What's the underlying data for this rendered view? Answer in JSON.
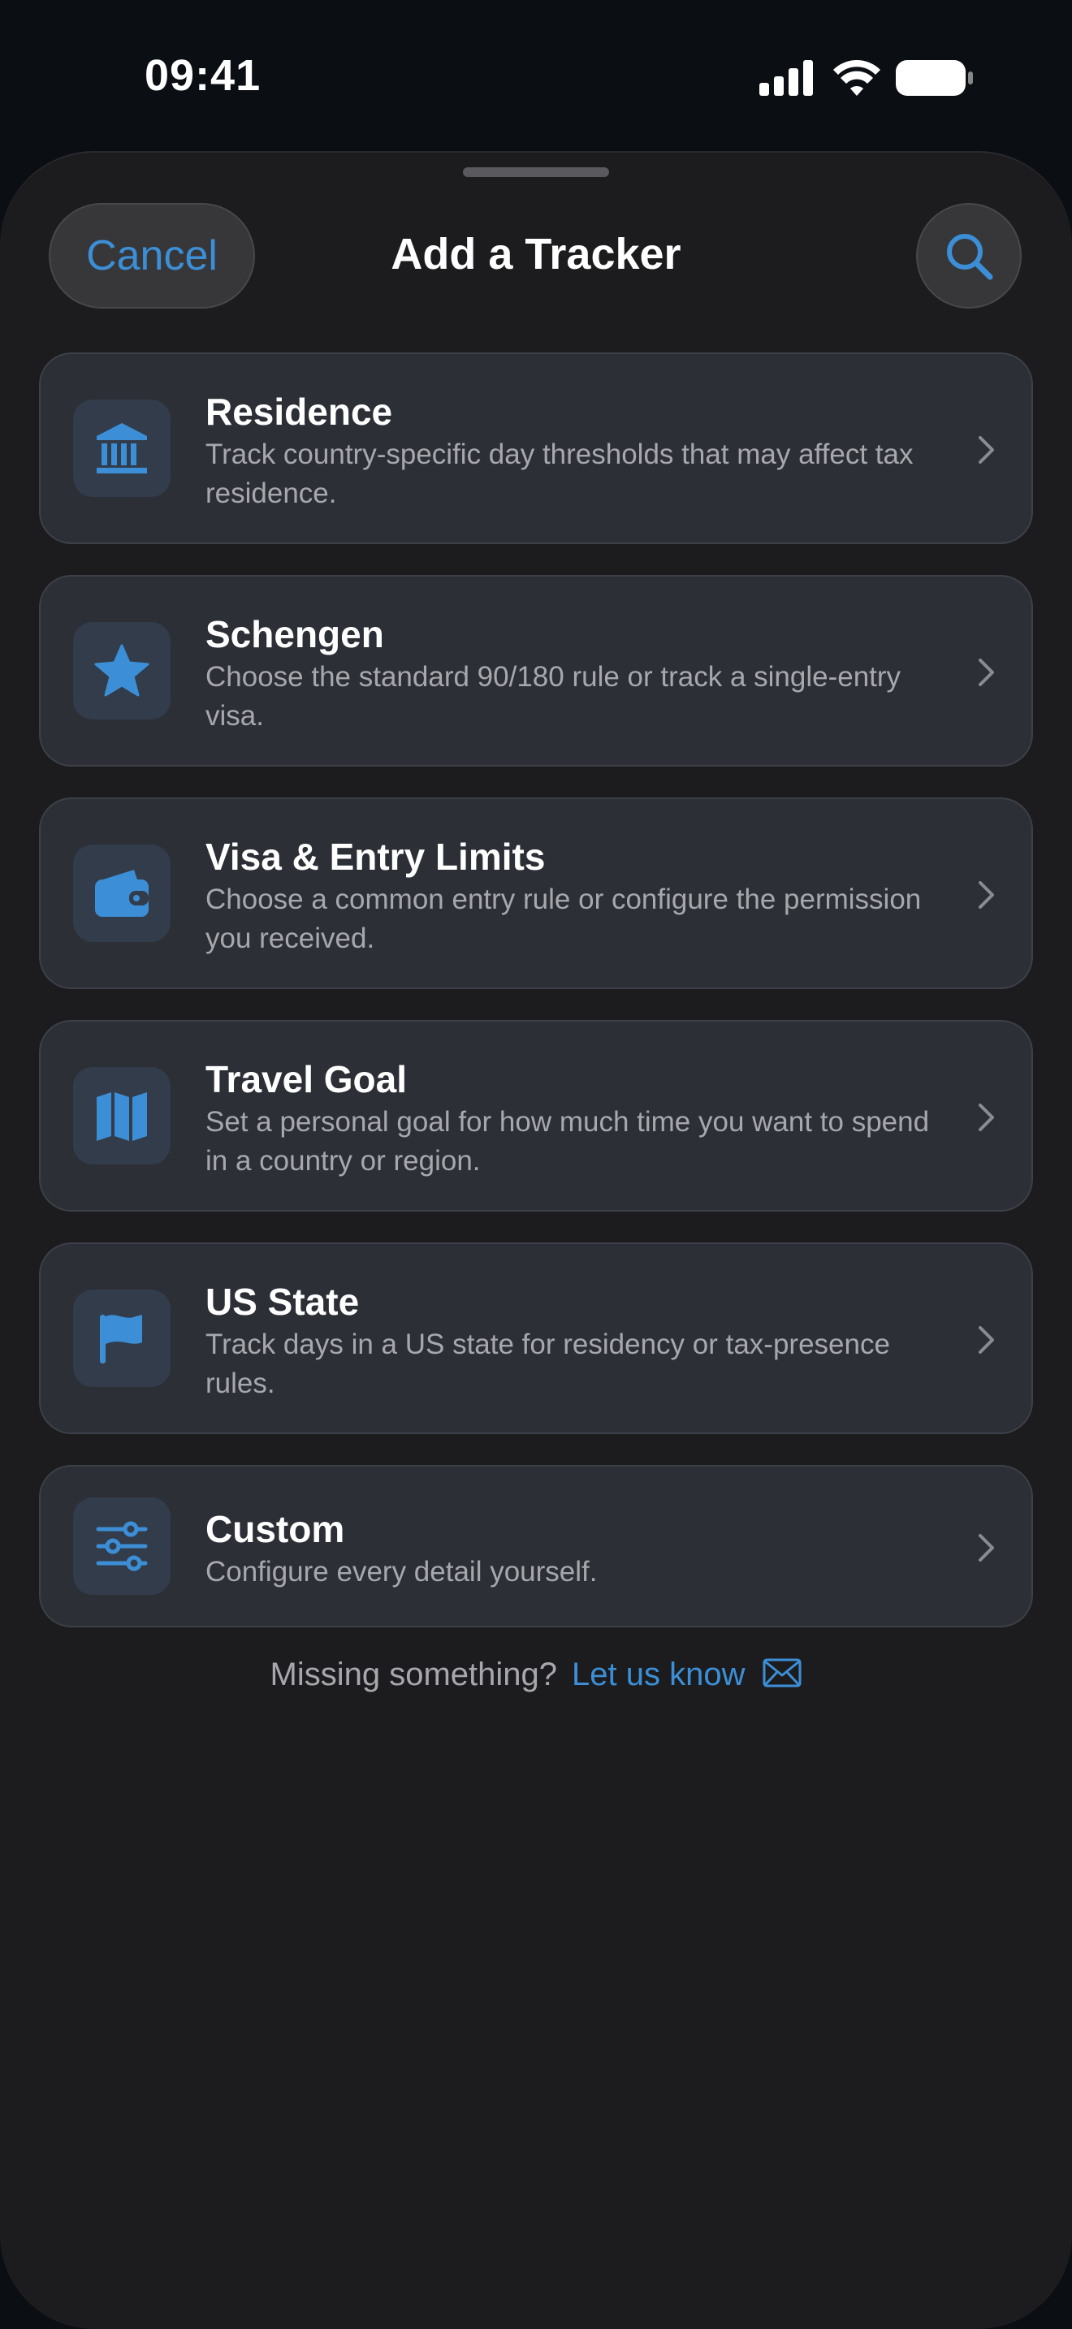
{
  "status_bar": {
    "time": "09:41"
  },
  "header": {
    "cancel_label": "Cancel",
    "title": "Add a Tracker"
  },
  "trackers": [
    {
      "title": "Residence",
      "description": "Track country-specific day thresholds that may affect tax residence.",
      "icon": "bank-icon"
    },
    {
      "title": "Schengen",
      "description": "Choose the standard 90/180 rule or track a single-entry visa.",
      "icon": "star-icon"
    },
    {
      "title": "Visa & Entry Limits",
      "description": "Choose a common entry rule or configure the permission you received.",
      "icon": "wallet-icon"
    },
    {
      "title": "Travel Goal",
      "description": "Set a personal goal for how much time you want to spend in a country or region.",
      "icon": "map-icon"
    },
    {
      "title": "US State",
      "description": "Track days in a US state for residency or tax-presence rules.",
      "icon": "flag-icon"
    },
    {
      "title": "Custom",
      "description": "Configure every detail yourself.",
      "icon": "sliders-icon"
    }
  ],
  "footer": {
    "prompt": "Missing something?",
    "link_label": "Let us know"
  },
  "colors": {
    "accent": "#3c8fd6",
    "sheet_background": "#1c1c1e",
    "card_background": "#2c2f36",
    "secondary_text": "#a6a8ad"
  }
}
